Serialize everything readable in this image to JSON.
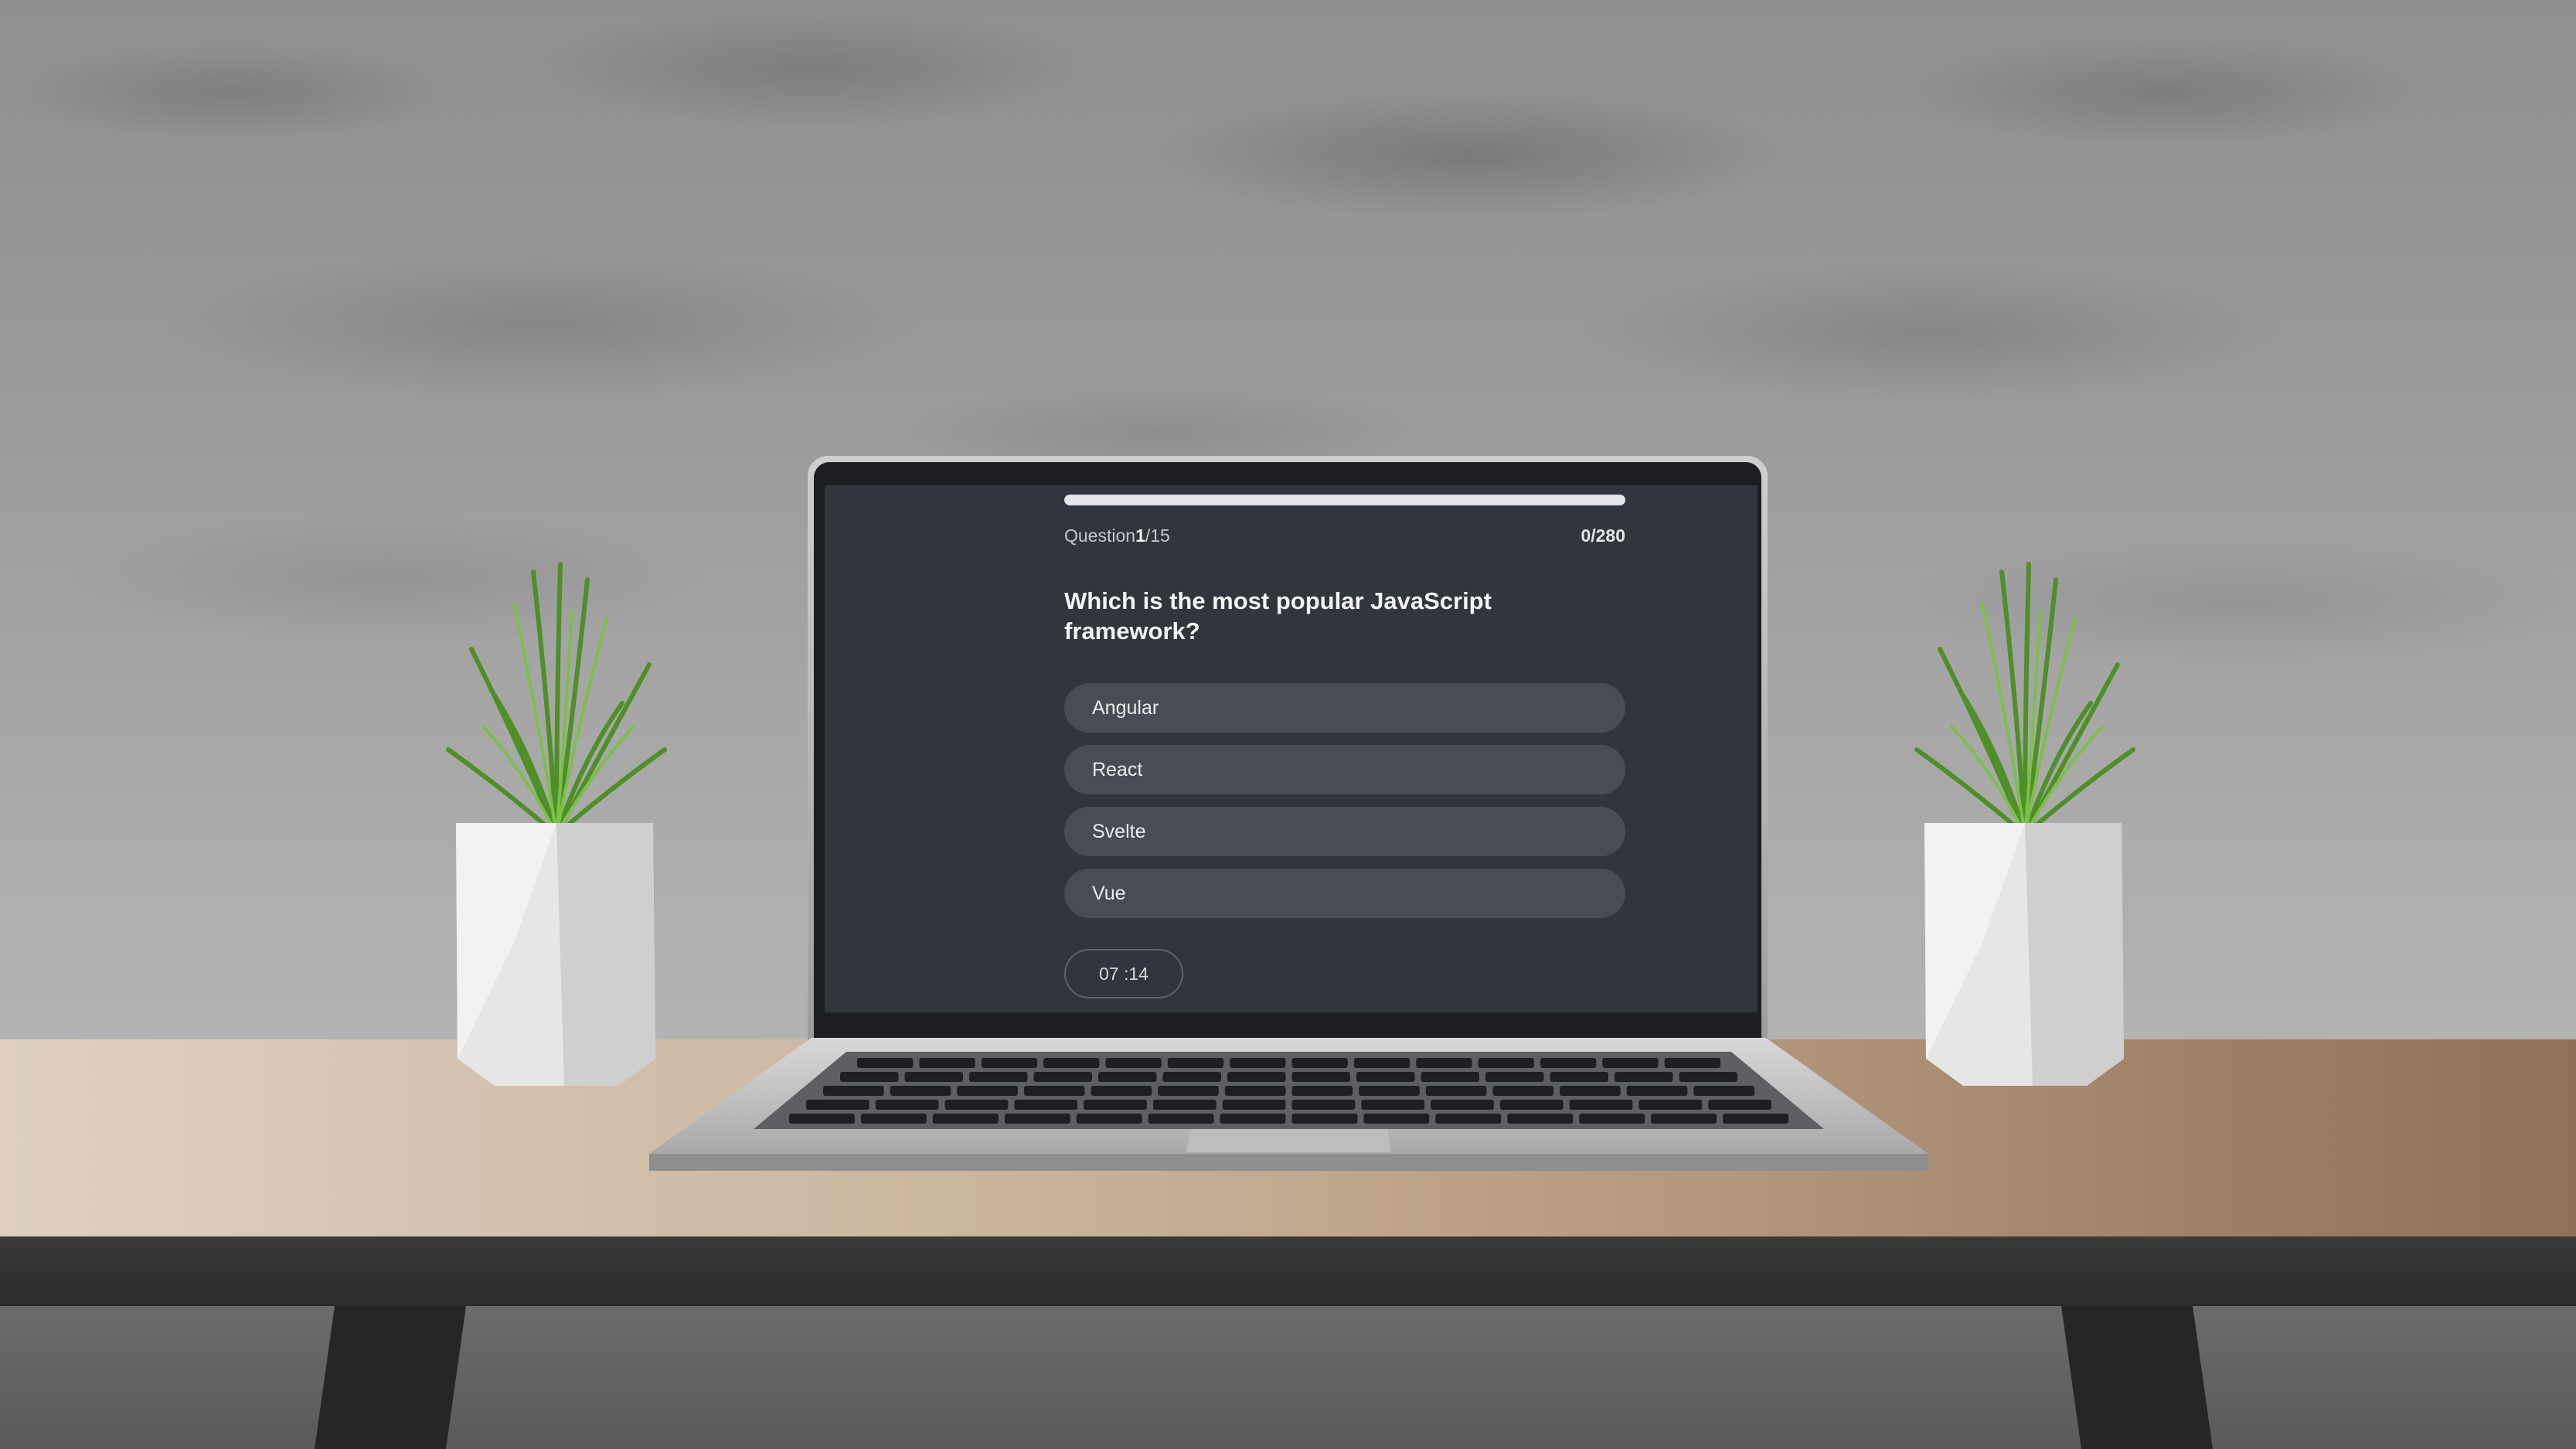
{
  "quiz": {
    "progress_fraction": 1.0,
    "question_label": "Question",
    "question_current": "1",
    "question_total": "/15",
    "score": "0/280",
    "question_text": "Which is the most popular JavaScript framework?",
    "options": [
      {
        "label": "Angular"
      },
      {
        "label": "React"
      },
      {
        "label": "Svelte"
      },
      {
        "label": "Vue"
      }
    ],
    "timer": "07 :14"
  },
  "colors": {
    "screen_bg": "#31353c",
    "option_bg": "#484c55",
    "progress_fill": "#e4e6ea",
    "plant_green": "#5a9a2e",
    "pot_white": "#e6e6e6"
  },
  "icons": {
    "scene": [
      "laptop",
      "plant-pot-left",
      "plant-pot-right",
      "desk"
    ]
  }
}
